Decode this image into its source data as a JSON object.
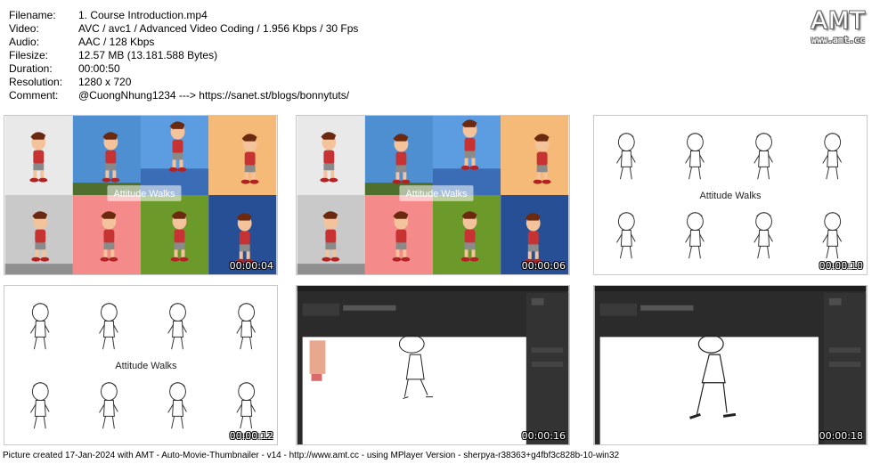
{
  "info": [
    {
      "key": "Filename:",
      "value": "1. Course Introduction.mp4"
    },
    {
      "key": "Video:",
      "value": "AVC / avc1 / Advanced Video Coding / 1.956 Kbps / 30 Fps"
    },
    {
      "key": "Audio:",
      "value": "AAC / 128 Kbps"
    },
    {
      "key": "Filesize:",
      "value": "12.57 MB (13.181.588 Bytes)"
    },
    {
      "key": "Duration:",
      "value": "00:00:50"
    },
    {
      "key": "Resolution:",
      "value": "1280 x 720"
    },
    {
      "key": "Comment:",
      "value": "@CuongNhung1234 ---> https://sanet.st/blogs/bonnytuts/"
    }
  ],
  "logo": {
    "big": "AMT",
    "small": "www.amt.cc"
  },
  "thumbnails": [
    {
      "time": "00:00:04",
      "caption": "Attitude Walks"
    },
    {
      "time": "00:00:06",
      "caption": "Attitude Walks"
    },
    {
      "time": "00:00:10",
      "caption": "Attitude Walks"
    },
    {
      "time": "00:00:12",
      "caption": "Attitude Walks"
    },
    {
      "time": "00:00:16"
    },
    {
      "time": "00:00:18"
    }
  ],
  "colors": {
    "grid": [
      "#e9e9e9",
      "#4e8fd1",
      "#5b9de0",
      "#f5b978",
      "#c9c9c9",
      "#f58a8a",
      "#6c9a2a",
      "#274f96"
    ],
    "editor_bg": "#2b2b2b",
    "character_shirt": "#c73232"
  },
  "footer": "Picture created 17-Jan-2024 with AMT - Auto-Movie-Thumbnailer - v14 - http://www.amt.cc - using MPlayer Version - sherpya-r38363+g4fbf3c828b-10-win32"
}
